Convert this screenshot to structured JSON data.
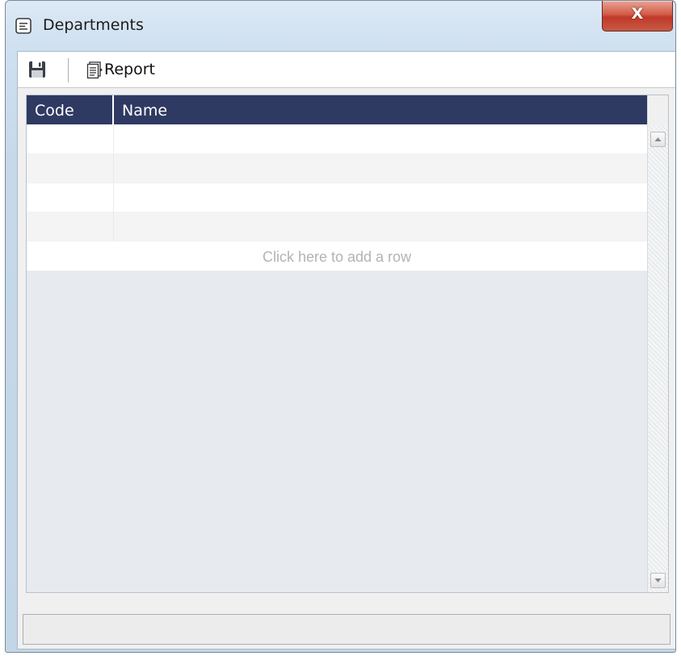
{
  "window": {
    "title": "Departments",
    "close_label": "X"
  },
  "toolbar": {
    "save_icon": "floppy-disk-icon",
    "report_label": "Report",
    "report_icon": "report-icon"
  },
  "grid": {
    "columns": [
      "Code",
      "Name"
    ],
    "rows": [
      {
        "code": "",
        "name": ""
      },
      {
        "code": "",
        "name": ""
      },
      {
        "code": "",
        "name": ""
      },
      {
        "code": "",
        "name": ""
      }
    ],
    "add_row_text": "Click here to add a row"
  },
  "statusbar": {
    "text": ""
  },
  "colors": {
    "header_bg": "#2f3a63",
    "close_button": "#c0392b",
    "window_frame": "#c6d8ea"
  }
}
